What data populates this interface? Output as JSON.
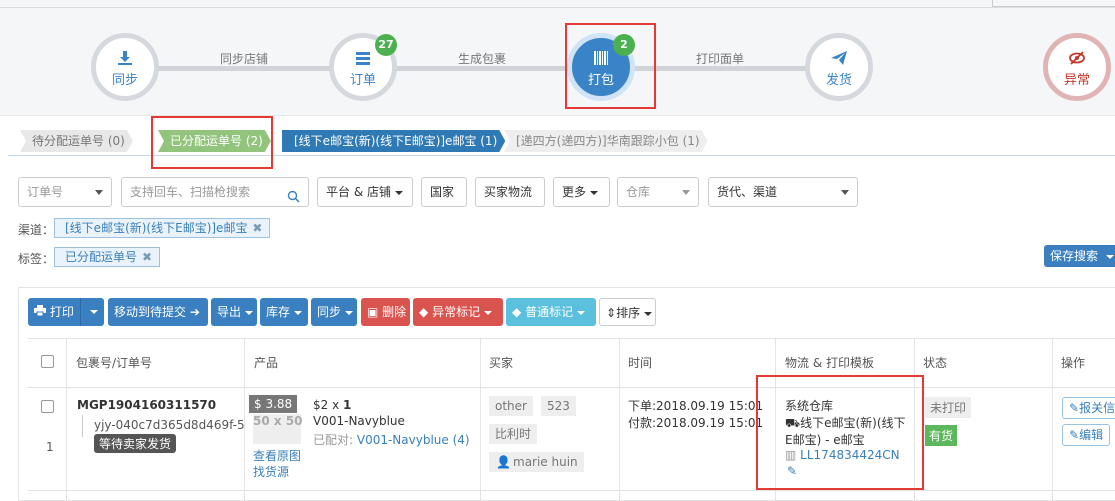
{
  "steps": [
    {
      "label": "同步",
      "icon": "download-icon"
    },
    {
      "label": "订单",
      "icon": "list-icon",
      "badge": "27"
    },
    {
      "label": "打包",
      "icon": "barcode-icon",
      "badge": "2"
    },
    {
      "label": "发货",
      "icon": "paper-plane-icon"
    },
    {
      "label": "异常",
      "icon": "eye-slash-icon"
    }
  ],
  "step_connectors": [
    "同步店铺",
    "生成包裹",
    "打印面单"
  ],
  "tabs": [
    "待分配运单号 (0)",
    "已分配运单号 (2)",
    "[线下e邮宝(新)(线下E邮宝)]e邮宝 (1)",
    "[递四方(递四方)]华南跟踪小包 (1)"
  ],
  "filters": {
    "order_no": "订单号",
    "search_placeholder": "支持回车、扫描枪搜索",
    "platform": "平台 & 店铺",
    "country": "国家",
    "buyer_logistics": "买家物流",
    "more": "更多",
    "warehouse": "仓库",
    "delivery_channel": "货代、渠道"
  },
  "tag_rows": {
    "channel_label": "渠道：",
    "channel_value": "[线下e邮宝(新)(线下E邮宝)]e邮宝",
    "tag_label": "标签：",
    "tag_value": "已分配运单号",
    "remove": "✖",
    "save_search": "保存搜索"
  },
  "toolbar": {
    "print": "打印",
    "move": "移动到待提交",
    "export": "导出",
    "stock": "库存",
    "sync": "同步",
    "delete": "删除",
    "abnormal_mark": "异常标记",
    "normal_mark": "普通标记",
    "sort": "排序"
  },
  "table": {
    "headers": [
      "包裹号/订单号",
      "产品",
      "买家",
      "时间",
      "物流 & 打印模板",
      "状态",
      "操作"
    ],
    "row": {
      "index": "1",
      "package_no": "MGP1904160311570",
      "order_no": "yjy-040c7d365d8d469f-5",
      "order_status": "等待卖家发货",
      "price_tag": "$ 3.88",
      "image_size": "50 x 50",
      "price_qty_prefix": "$2 x ",
      "qty": "1",
      "sku": "V001-Navyblue",
      "paired_label": "已配对: ",
      "paired_value": "V001-Navyblue (4)",
      "view_image": "查看原图",
      "find_source": "找货源",
      "buyer_tags": [
        "other",
        "523",
        "比利时",
        "marie huin"
      ],
      "order_time": "下单:2018.09.19 15:01",
      "pay_time": "付款:2018.09.19 15:01",
      "warehouse": "系统仓库",
      "channel_line1": "线下e邮宝(新)(线下",
      "channel_line2": "E邮宝) - e邮宝",
      "tracking_no": "LL174834424CN",
      "print_status": "未打印",
      "stock_status": "有货",
      "action_report": "报关信",
      "action_edit": "编辑"
    }
  },
  "colors": {
    "primary": "#3a83c7",
    "success": "#4caf50",
    "danger": "#d9534f",
    "info": "#5bc0de",
    "highlight": "#e53935"
  }
}
